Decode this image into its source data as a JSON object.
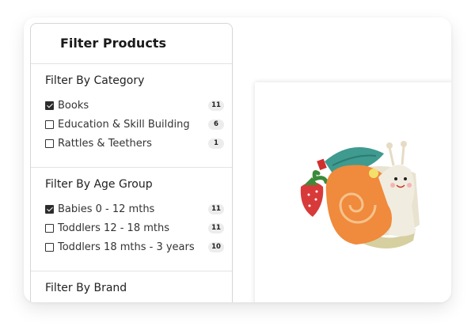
{
  "filter": {
    "title": "Filter Products",
    "sections": [
      {
        "title": "Filter By Category",
        "options": [
          {
            "label": "Books",
            "checked": true,
            "count": "11"
          },
          {
            "label": "Education & Skill Building",
            "checked": false,
            "count": "6"
          },
          {
            "label": "Rattles & Teethers",
            "checked": false,
            "count": "1"
          }
        ]
      },
      {
        "title": "Filter By Age Group",
        "options": [
          {
            "label": "Babies 0 - 12 mths",
            "checked": true,
            "count": "11"
          },
          {
            "label": "Toddlers 12 - 18 mths",
            "checked": false,
            "count": "11"
          },
          {
            "label": "Toddlers 18 mths - 3 years",
            "checked": false,
            "count": "10"
          }
        ]
      },
      {
        "title": "Filter By Brand",
        "options": []
      }
    ]
  },
  "product": {
    "image_icon": "snail-soft-book-toy-image"
  },
  "colors": {
    "snail_shell": "#f08a3c",
    "snail_body": "#f1ece0",
    "leaf": "#3f9a8f",
    "strawberry": "#d83a3a"
  }
}
